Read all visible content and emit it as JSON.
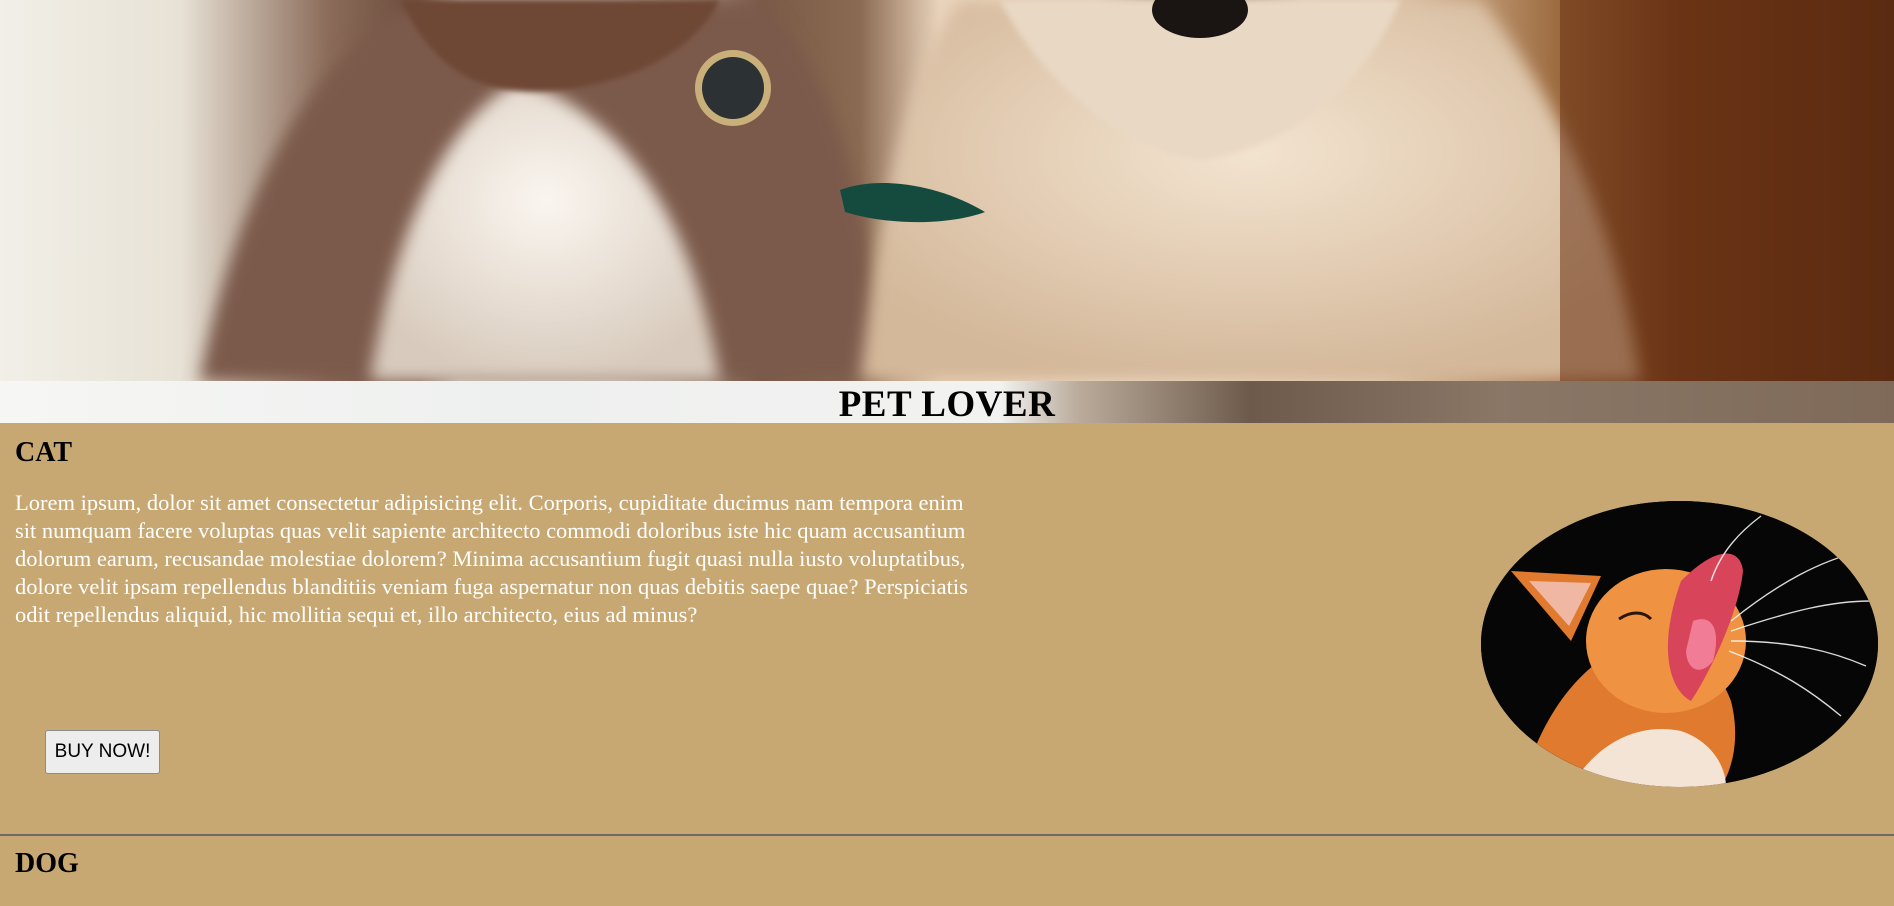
{
  "site": {
    "title": "PET LOVER"
  },
  "hero": {
    "image": "two-dogs-photo"
  },
  "sections": [
    {
      "title": "CAT",
      "body": "Lorem ipsum, dolor sit amet consectetur adipisicing elit. Corporis, cupiditate ducimus nam tempora enim sit numquam facere voluptas quas velit sapiente architecto commodi doloribus iste hic quam accusantium dolorum earum, recusandae molestiae dolorem? Minima accusantium fugit quasi nulla iusto voluptatibus, dolore velit ipsam repellendus blanditiis veniam fuga aspernatur non quas debitis saepe quae? Perspiciatis odit repellendus aliquid, hic mollitia sequi et, illo architecto, eius ad minus?",
      "button_label": "BUY NOW!",
      "image": "yawning-cat-photo"
    },
    {
      "title": "DOG"
    }
  ],
  "colors": {
    "page_background": "#c8a872",
    "body_text": "#ffffff",
    "heading_text": "#000000"
  }
}
